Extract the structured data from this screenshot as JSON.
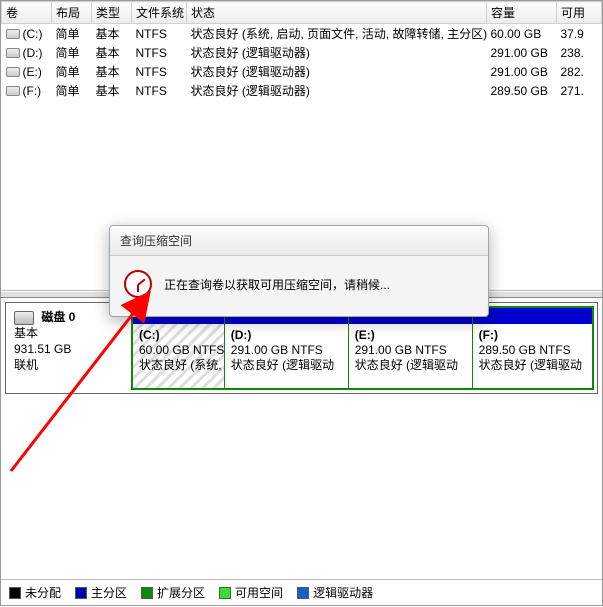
{
  "columns": {
    "vol": "卷",
    "layout": "布局",
    "type": "类型",
    "fs": "文件系统",
    "status": "状态",
    "cap": "容量",
    "free": "可用"
  },
  "volumes": [
    {
      "name": "(C:)",
      "layout": "简单",
      "type": "基本",
      "fs": "NTFS",
      "status": "状态良好 (系统, 启动, 页面文件, 活动, 故障转储, 主分区)",
      "cap": "60.00 GB",
      "free": "37.9"
    },
    {
      "name": "(D:)",
      "layout": "简单",
      "type": "基本",
      "fs": "NTFS",
      "status": "状态良好 (逻辑驱动器)",
      "cap": "291.00 GB",
      "free": "238."
    },
    {
      "name": "(E:)",
      "layout": "简单",
      "type": "基本",
      "fs": "NTFS",
      "status": "状态良好 (逻辑驱动器)",
      "cap": "291.00 GB",
      "free": "282."
    },
    {
      "name": "(F:)",
      "layout": "简单",
      "type": "基本",
      "fs": "NTFS",
      "status": "状态良好 (逻辑驱动器)",
      "cap": "289.50 GB",
      "free": "271."
    }
  ],
  "disk": {
    "label": "磁盘 0",
    "type": "基本",
    "size": "931.51 GB",
    "state": "联机"
  },
  "partitions": [
    {
      "letter": "(C:)",
      "line2": "60.00 GB NTFS",
      "line3": "状态良好 (系统, 启"
    },
    {
      "letter": "(D:)",
      "line2": "291.00 GB NTFS",
      "line3": "状态良好 (逻辑驱动"
    },
    {
      "letter": "(E:)",
      "line2": "291.00 GB NTFS",
      "line3": "状态良好 (逻辑驱动"
    },
    {
      "letter": "(F:)",
      "line2": "289.50 GB NTFS",
      "line3": "状态良好 (逻辑驱动"
    }
  ],
  "dialog": {
    "title": "查询压缩空间",
    "message": "正在查询卷以获取可用压缩空间，请稍候..."
  },
  "legend": {
    "unalloc": "未分配",
    "primary": "主分区",
    "ext": "扩展分区",
    "free": "可用空间",
    "logical": "逻辑驱动器"
  },
  "colors": {
    "unalloc": "#000000",
    "primary": "#0000aa",
    "ext": "#0a8a0a",
    "free": "#35e035",
    "logical": "#1560d0"
  }
}
